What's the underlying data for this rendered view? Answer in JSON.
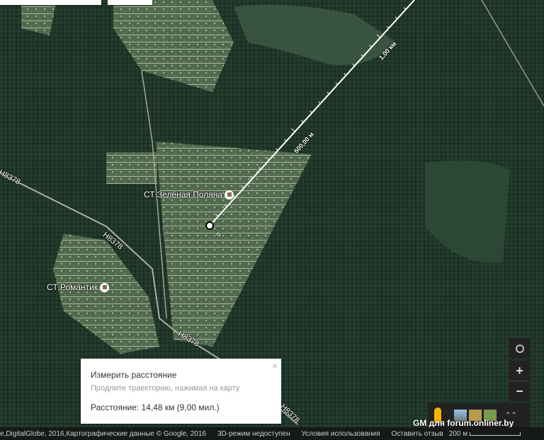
{
  "map": {
    "places": [
      {
        "name": "СТ Зелёная Поляна"
      },
      {
        "name": "СТ Романтик"
      }
    ],
    "road_label": "H8378",
    "measure_line": {
      "start_label": "0",
      "mid_label": "500,00 м",
      "end_label": "1,00 км"
    }
  },
  "measure_card": {
    "title": "Измерить расстояние",
    "hint": "Продлите траекторию, нажимая на карту",
    "distance": "Расстояние: 14,48 км (9,00 мил.)",
    "close_icon": "×"
  },
  "controls": {
    "zoom_in": "+",
    "zoom_out": "−",
    "expand": "⌃⌃"
  },
  "footer": {
    "attribution": "e,DigitalGlobe, 2016,Картографические данные © Google, 2016",
    "three_d": "3D-режим недоступен",
    "terms": "Условия использования",
    "feedback": "Оставить отзыв",
    "scale": "200 м"
  },
  "brand": "GM для forum.onliner.by"
}
